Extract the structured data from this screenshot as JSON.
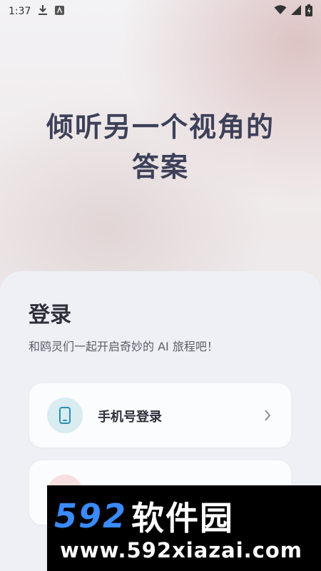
{
  "status_bar": {
    "time": "1:37",
    "icons": [
      "download-icon",
      "a-notification-icon",
      "wifi-icon",
      "signal-icon",
      "battery-icon"
    ]
  },
  "hero": {
    "line1": "倾听另一个视角的",
    "line2": "答案"
  },
  "login": {
    "title": "登录",
    "subtitle": "和鸥灵们一起开启奇妙的 AI 旅程吧！",
    "options": [
      {
        "label": "手机号登录",
        "icon": "phone-icon",
        "accent": "#d8ecf1"
      },
      {
        "label": "",
        "icon": "other-login-icon",
        "accent": "#f6dfe0"
      }
    ]
  },
  "watermark": {
    "number": "592",
    "name": "软件园",
    "url": "www.592xiazai.com"
  },
  "colors": {
    "hero_text": "#3d4058",
    "card_bg": "#eff0f5",
    "brand_blue": "#3a8bff"
  }
}
